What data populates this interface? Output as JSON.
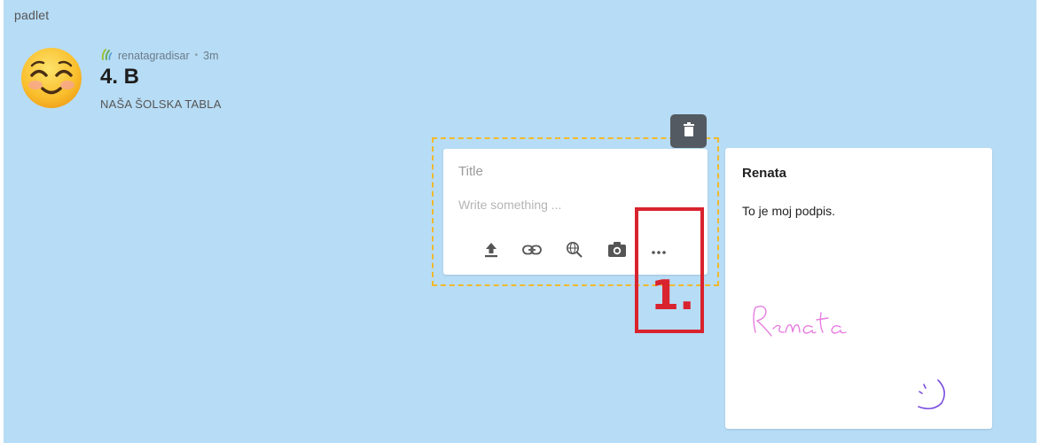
{
  "app": {
    "brand": "padlet"
  },
  "board": {
    "author": "renatagradisar",
    "separator": "•",
    "age": "3m",
    "title": "4. B",
    "subtitle": "NAŠA ŠOLSKA TABLA"
  },
  "composer": {
    "title_placeholder": "Title",
    "body_placeholder": "Write something ...",
    "toolbar": [
      {
        "icon": "upload-icon"
      },
      {
        "icon": "link-icon"
      },
      {
        "icon": "search-web-icon"
      },
      {
        "icon": "camera-icon"
      },
      {
        "icon": "more-icon"
      }
    ],
    "delete_icon": "trash-icon",
    "highlight_color": "#f0b92c"
  },
  "annotation": {
    "label": "1.",
    "color": "#d9232e"
  },
  "note": {
    "title": "Renata",
    "body": "To je moj podpis.",
    "signature": "Renata"
  },
  "colors": {
    "background": "#b7dcf5",
    "card": "#ffffff",
    "trash_button": "#545a61"
  }
}
